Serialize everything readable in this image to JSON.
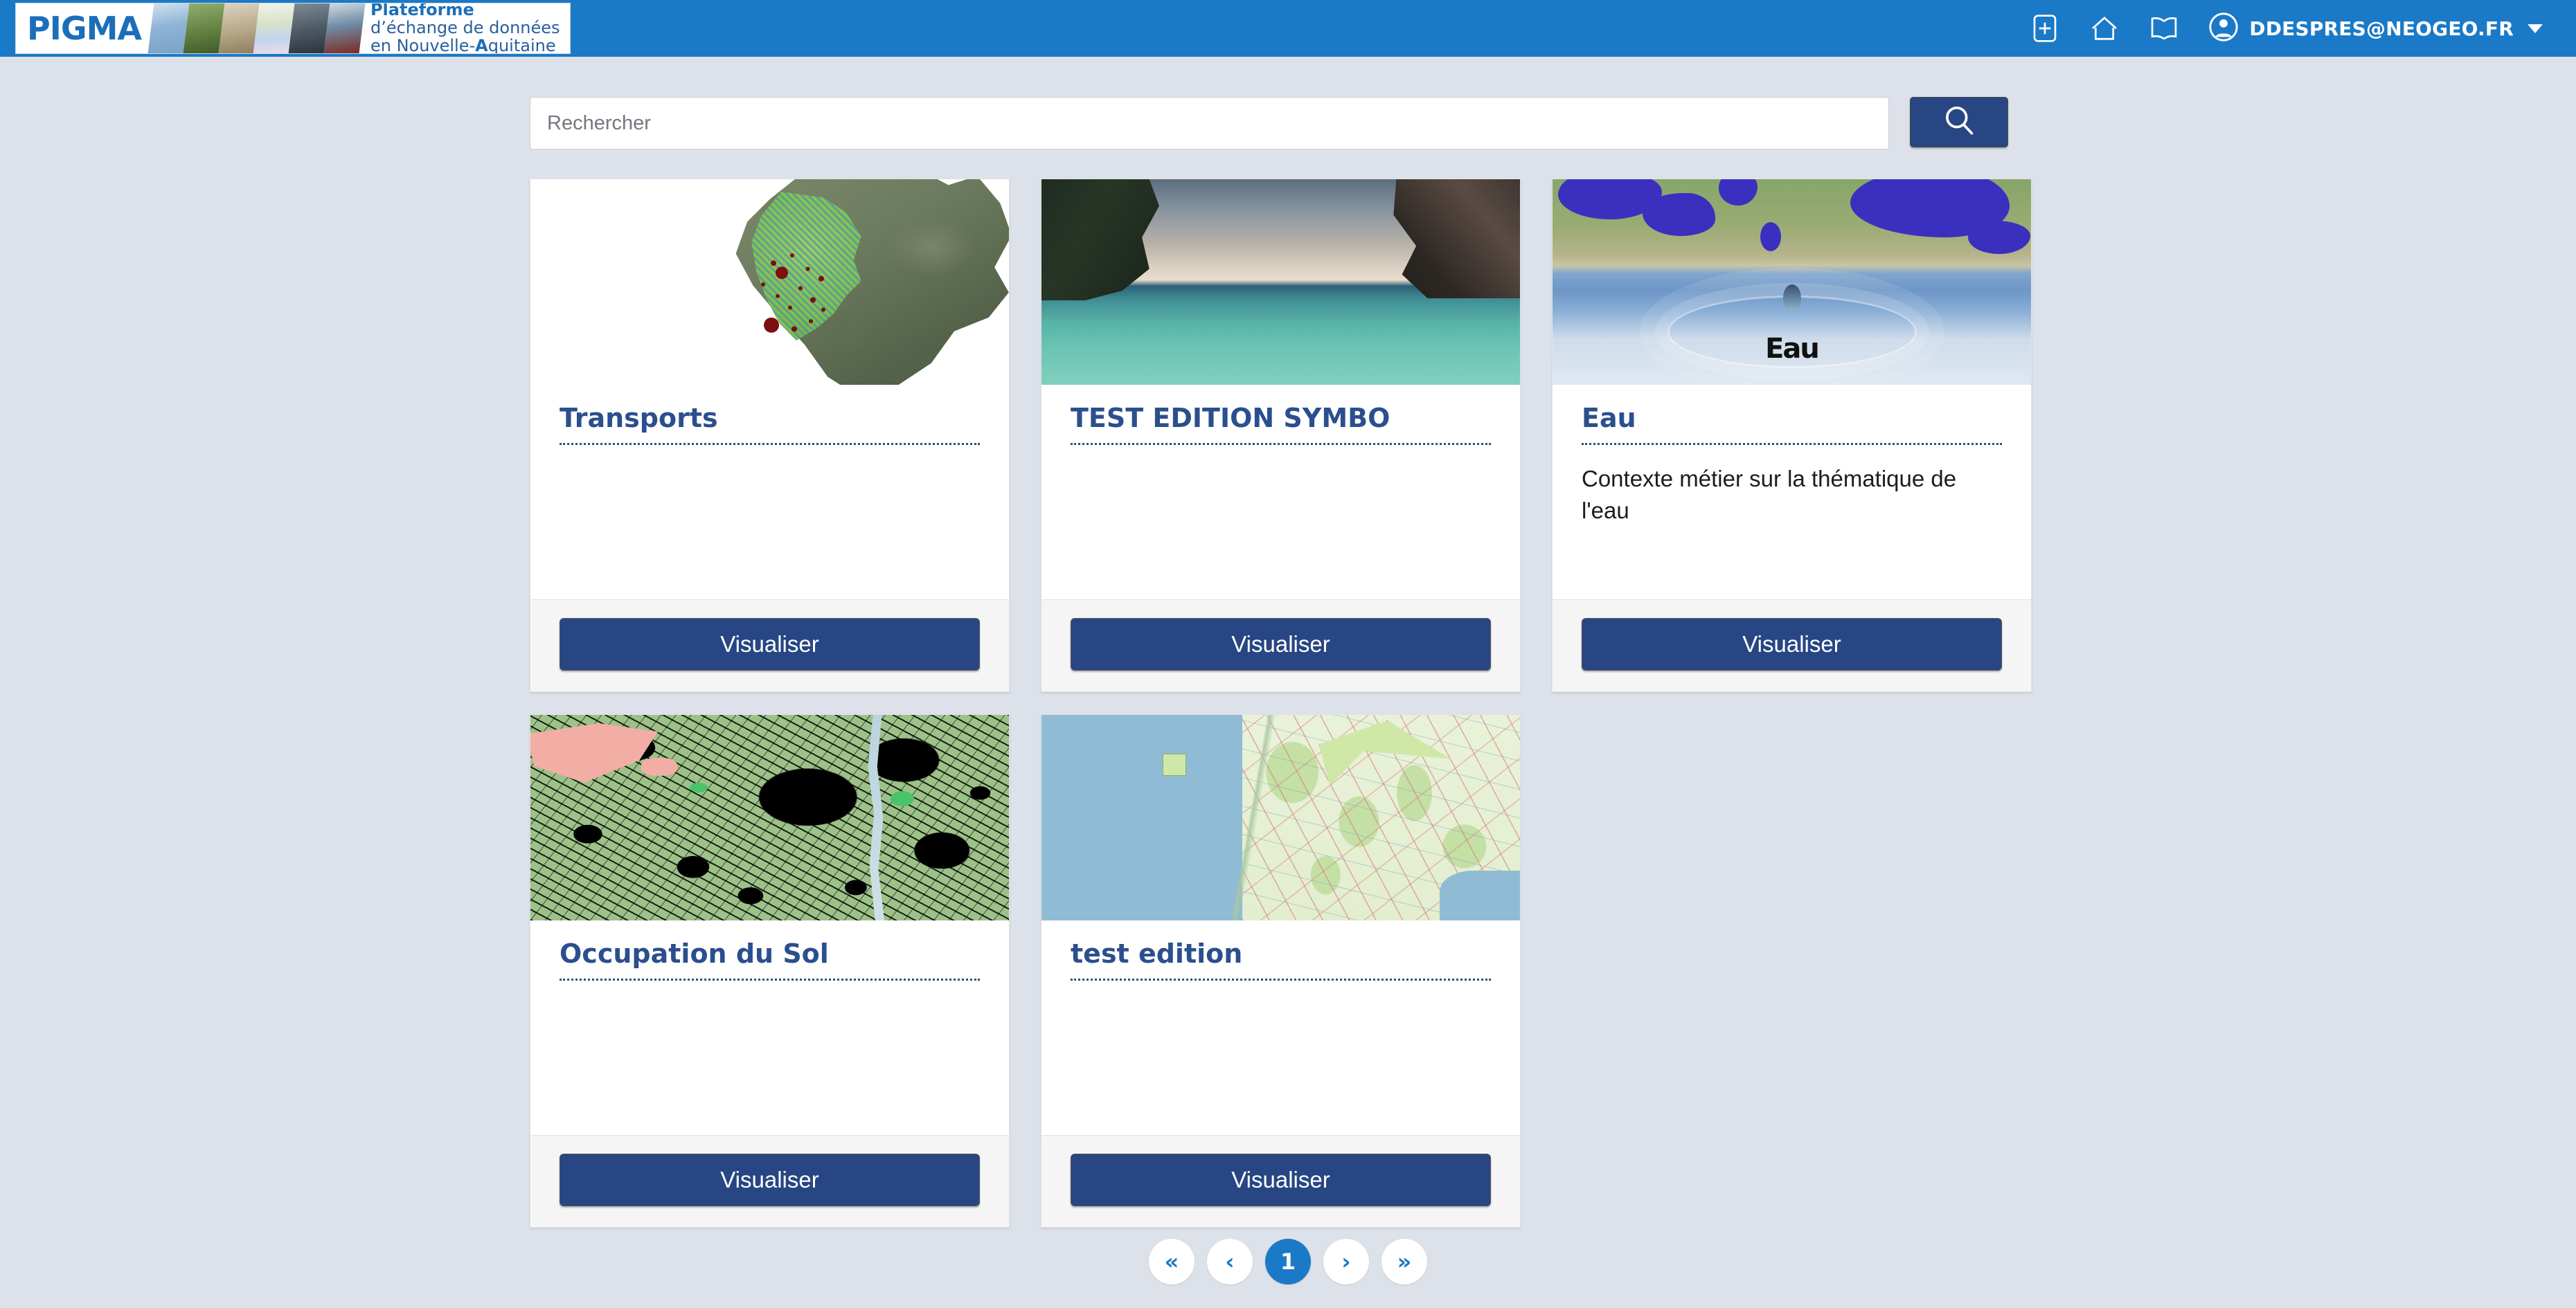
{
  "header": {
    "logo_text": "PIGMA",
    "logo_tagline_1": "Plateforme",
    "logo_tagline_2": "d’échange de données",
    "logo_tagline_3_a": "en Nouvelle-",
    "logo_tagline_3_b": "A",
    "logo_tagline_3_c": "quitaine",
    "icons": {
      "add": "plus-square-icon",
      "home": "home-icon",
      "book": "book-icon",
      "avatar": "user-avatar-icon",
      "caret": "chevron-down-icon"
    },
    "user_name": "DDESPRES@NEOGEO.FR",
    "bar_color": "#1a7ac7"
  },
  "search": {
    "placeholder": "Rechercher",
    "value": "",
    "button_icon": "search-icon",
    "button_color": "#274683"
  },
  "cards": [
    {
      "title": "Transports",
      "description": "",
      "button_label": "Visualiser",
      "image_alt": "satellite-map-nouvelle-aquitaine-transport-points"
    },
    {
      "title": "TEST EDITION SYMBO",
      "description": "",
      "button_label": "Visualiser",
      "image_alt": "tropical-bay-cliffs-photo"
    },
    {
      "title": "Eau",
      "description": "Contexte métier sur la thématique de l'eau",
      "button_label": "Visualiser",
      "image_alt": "water-drop-ripple-over-lakes-map",
      "image_caption": "Eau"
    },
    {
      "title": "Occupation du Sol",
      "description": "",
      "button_label": "Visualiser",
      "image_alt": "land-use-map-green-black-pink"
    },
    {
      "title": "test edition",
      "description": "",
      "button_label": "Visualiser",
      "image_alt": "topographic-map-atlantic-coast"
    }
  ],
  "pagination": {
    "first": "«",
    "prev": "‹",
    "pages": [
      "1"
    ],
    "current": "1",
    "next": "›",
    "last": "»",
    "active_color": "#1a7ac7"
  },
  "theme": {
    "page_background": "#dde1ea",
    "card_title_color": "#2b4f8e",
    "navy": "#274683"
  }
}
